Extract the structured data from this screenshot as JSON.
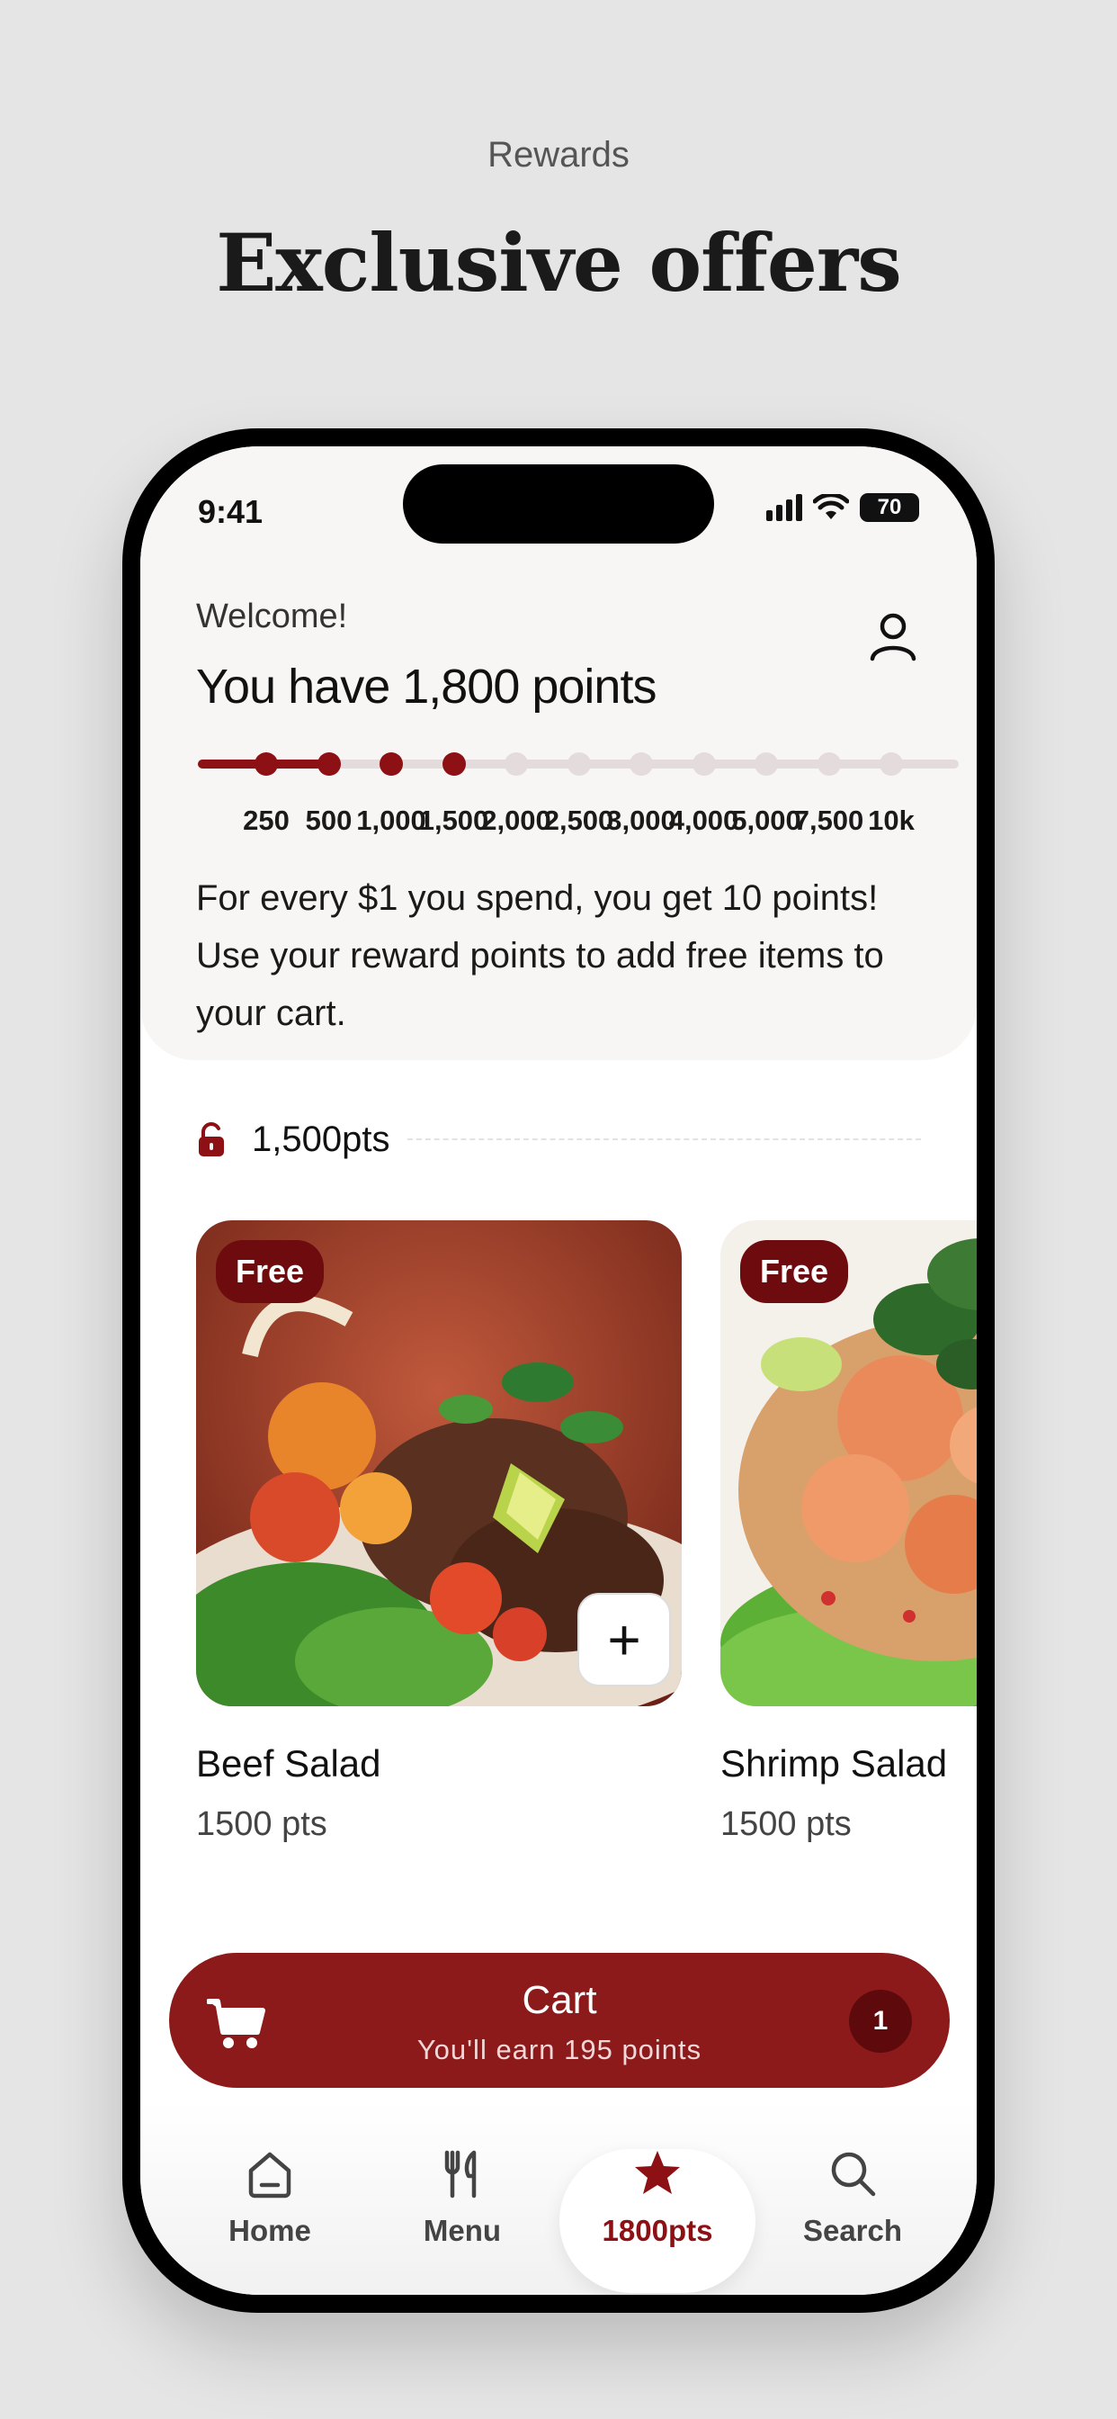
{
  "header": {
    "eyebrow": "Rewards",
    "headline": "Exclusive offers"
  },
  "status_bar": {
    "time": "9:41",
    "battery": "70"
  },
  "rewards": {
    "welcome": "Welcome!",
    "points_title": "You have 1,800 points",
    "progress": {
      "current_points": 1800,
      "milestones": [
        "250",
        "500",
        "1,000",
        "1,500",
        "2,000",
        "2,500",
        "3,000",
        "4,000",
        "5,000",
        "7,500",
        "10k"
      ],
      "reached_count": 4
    },
    "info": "For every $1 you spend, you get 10 points! Use your reward points to add free items to your cart."
  },
  "tier": {
    "label": "1,500pts"
  },
  "items": [
    {
      "badge": "Free",
      "name": "Beef Salad",
      "points": "1500 pts",
      "add_icon": "plus-icon"
    },
    {
      "badge": "Free",
      "name": "Shrimp Salad",
      "points": "1500 pts"
    }
  ],
  "cart": {
    "title": "Cart",
    "subtitle": "You'll earn 195 points",
    "count": "1"
  },
  "tabs": [
    {
      "label": "Home",
      "icon": "home-icon"
    },
    {
      "label": "Menu",
      "icon": "utensils-icon"
    },
    {
      "label": "1800pts",
      "icon": "star-icon",
      "active": true
    },
    {
      "label": "Search",
      "icon": "search-icon"
    }
  ],
  "colors": {
    "accent": "#8c1014",
    "cart_bg": "#8d1a1a",
    "badge_bg": "#6e0b0e",
    "panel_bg": "#f8f5f5"
  }
}
